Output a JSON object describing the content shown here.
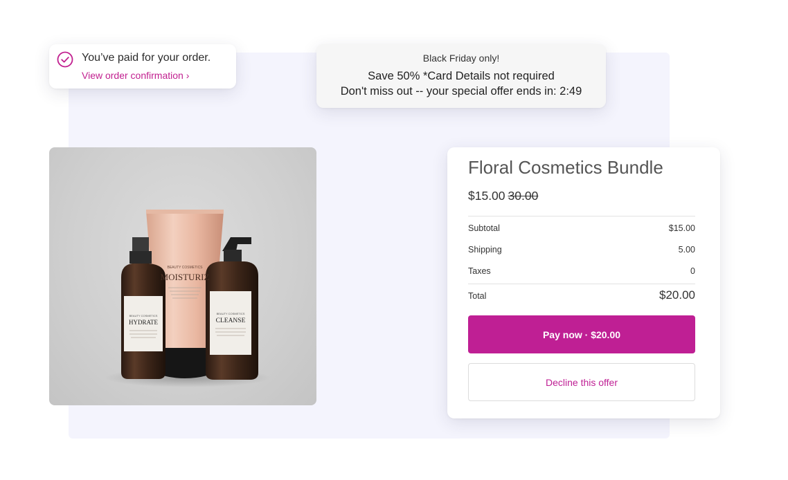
{
  "paid_notice": {
    "message": "You’ve paid for your order.",
    "link_label": "View order confirmation ›",
    "icon": "check-circle-icon"
  },
  "promo": {
    "line1": "Black Friday only!",
    "line2": "Save 50% *Card Details not required",
    "line3_prefix": "Don't miss out -- your special offer ends in: ",
    "timer": "2:49"
  },
  "product_image": {
    "labels": {
      "tube_brand": "BEAUTY COSMETICS",
      "tube_name": "MOISTURIZ",
      "left_brand": "BEAUTY COSMETICS",
      "left_name": "HYDRATE",
      "right_brand": "BEAUTY COSMETICS",
      "right_name": "CLEANSE"
    }
  },
  "offer": {
    "title": "Floral Cosmetics Bundle",
    "price": "$15.00",
    "original_price": "30.00",
    "summary": {
      "subtotal_label": "Subtotal",
      "subtotal_value": "$15.00",
      "shipping_label": "Shipping",
      "shipping_value": "5.00",
      "taxes_label": "Taxes",
      "taxes_value": "0",
      "total_label": "Total",
      "total_value": "$20.00"
    },
    "pay_button": "Pay now · $20.00",
    "decline_button": "Decline this offer"
  },
  "colors": {
    "accent": "#bf1f94",
    "backdrop": "#f4f4fd",
    "promo_bg": "#f6f6f6"
  }
}
